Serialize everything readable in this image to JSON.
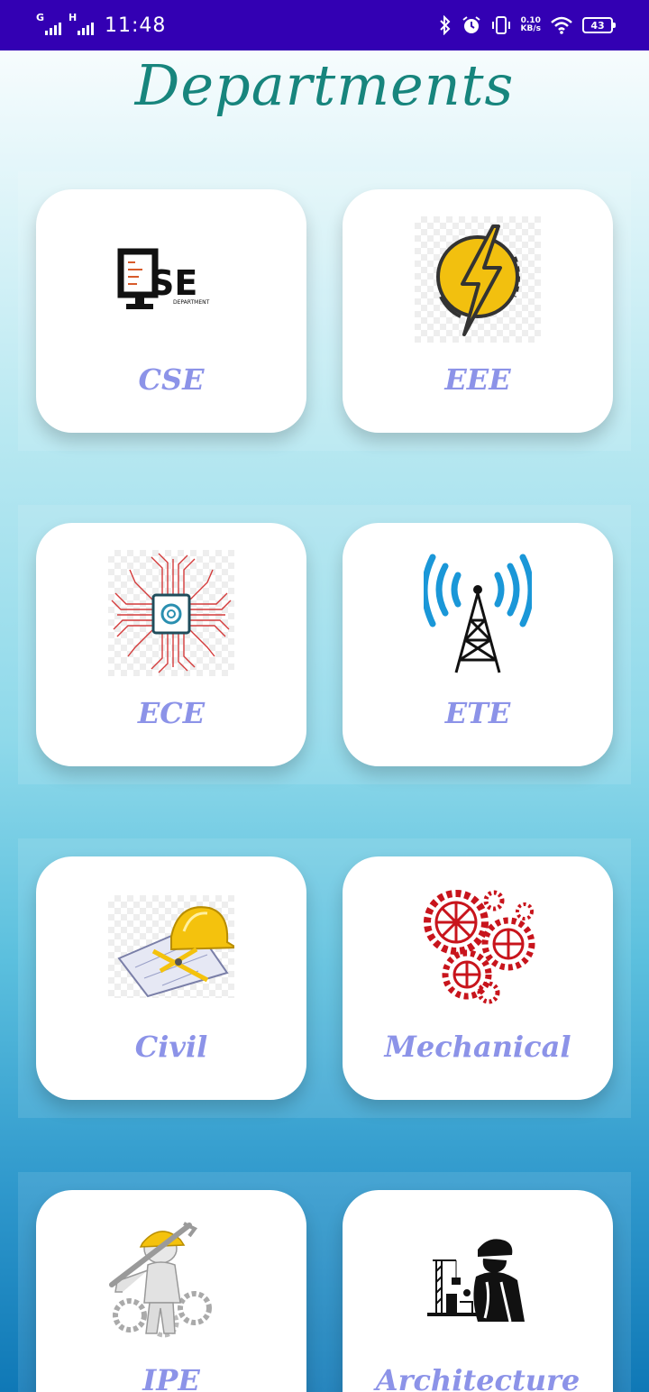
{
  "status_bar": {
    "network_1": "G",
    "network_2": "H",
    "time": "11:48",
    "speed_value": "0.10",
    "speed_unit": "KB/s",
    "battery": "43"
  },
  "title": "Departments",
  "departments": [
    {
      "label": "CSE",
      "icon": "cse-logo-icon"
    },
    {
      "label": "EEE",
      "icon": "lightning-bolt-icon"
    },
    {
      "label": "ECE",
      "icon": "circuit-chip-icon"
    },
    {
      "label": "ETE",
      "icon": "antenna-tower-icon"
    },
    {
      "label": "Civil",
      "icon": "hardhat-blueprint-icon"
    },
    {
      "label": "Mechanical",
      "icon": "gears-icon"
    },
    {
      "label": "IPE",
      "icon": "engineer-wrench-icon"
    },
    {
      "label": "Architecture",
      "icon": "construction-worker-icon"
    }
  ],
  "colors": {
    "status_bar": "#3300b3",
    "title": "#17857d",
    "card_label": "#8c93e8",
    "card_bg": "#ffffff"
  }
}
